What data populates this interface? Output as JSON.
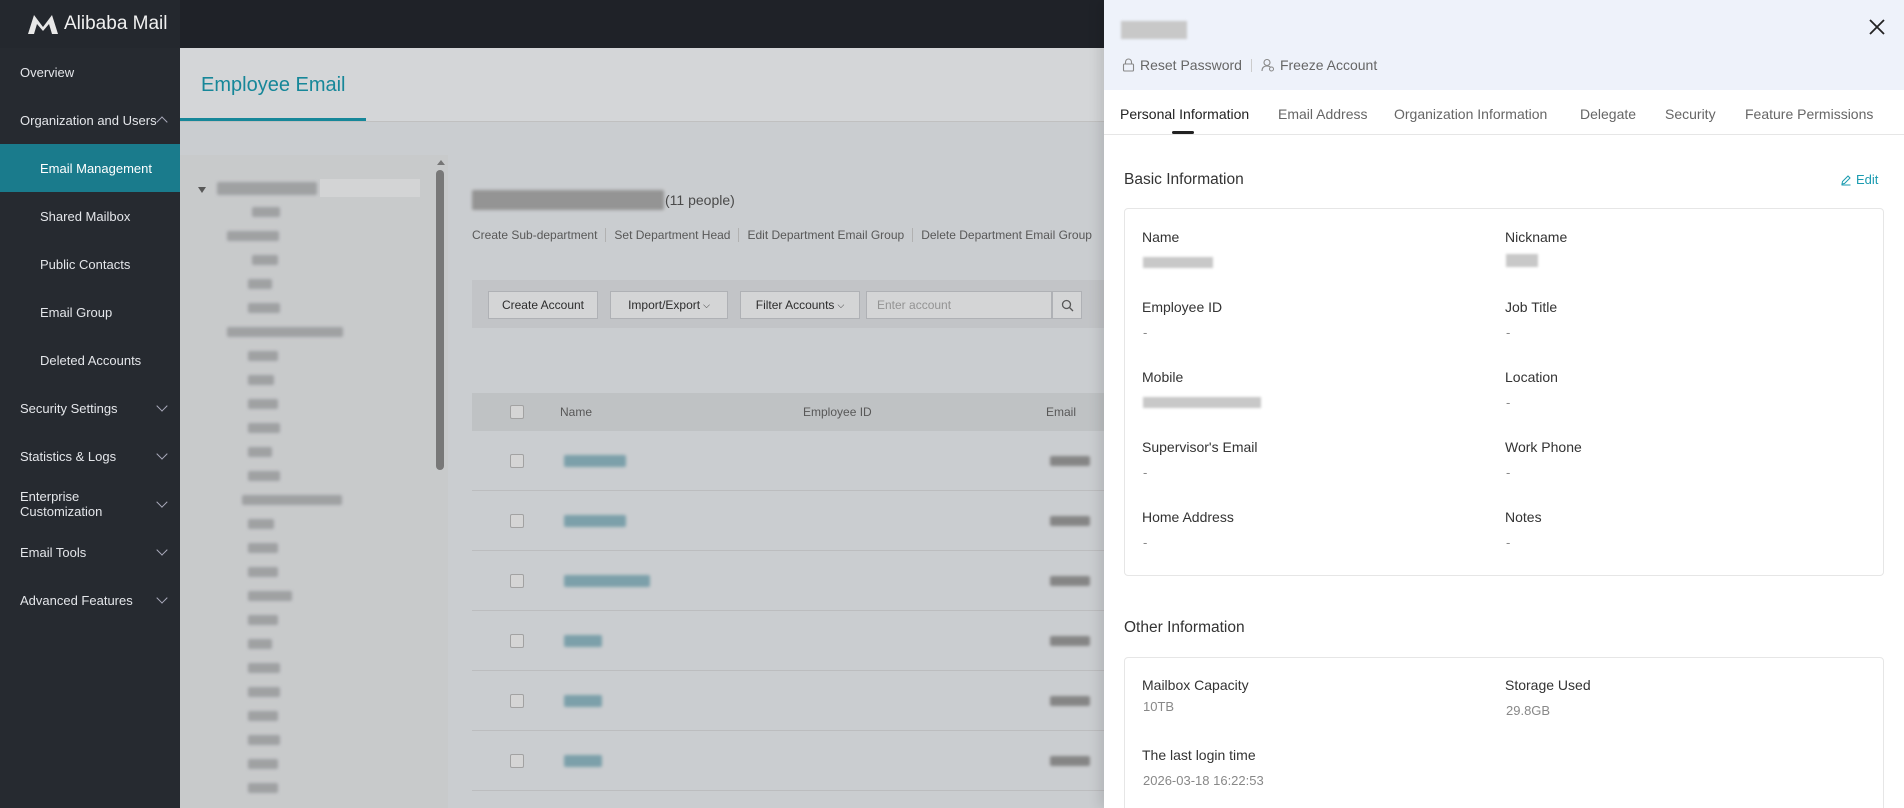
{
  "app": {
    "brand": "Alibaba Mail",
    "accent": "#1a7b8c",
    "link_color": "#1a9bb0"
  },
  "sidebar": {
    "items": [
      {
        "label": "Overview"
      },
      {
        "label": "Organization and Users"
      },
      {
        "label": "Email Management"
      },
      {
        "label": "Shared Mailbox"
      },
      {
        "label": "Public Contacts"
      },
      {
        "label": "Email Group"
      },
      {
        "label": "Deleted Accounts"
      },
      {
        "label": "Security Settings"
      },
      {
        "label": "Statistics & Logs"
      },
      {
        "label": "Enterprise Customization"
      },
      {
        "label": "Email Tools"
      },
      {
        "label": "Advanced Features"
      }
    ]
  },
  "main": {
    "title": "Employee Email",
    "dept_count": "(11 people)",
    "dept_links": [
      "Create Sub-department",
      "Set Department Head",
      "Edit Department Email Group",
      "Delete Department Email Group"
    ],
    "toolbar": {
      "create": "Create Account",
      "import_export": "Import/Export",
      "filter": "Filter Accounts",
      "search_placeholder": "Enter account"
    },
    "table": {
      "columns": [
        "Name",
        "Employee ID",
        "Email"
      ]
    }
  },
  "drawer": {
    "actions": {
      "reset": "Reset Password",
      "freeze": "Freeze Account"
    },
    "tabs": [
      "Personal Information",
      "Email Address",
      "Organization Information",
      "Delegate",
      "Security",
      "Feature Permissions"
    ],
    "basic": {
      "title": "Basic Information",
      "edit": "Edit",
      "fields": {
        "name": "Name",
        "nickname": "Nickname",
        "employee_id": "Employee ID",
        "employee_id_val": "-",
        "job_title": "Job Title",
        "job_title_val": "-",
        "mobile": "Mobile",
        "location": "Location",
        "location_val": "-",
        "supervisor_email": "Supervisor's Email",
        "supervisor_email_val": "-",
        "work_phone": "Work Phone",
        "work_phone_val": "-",
        "home_address": "Home Address",
        "home_address_val": "-",
        "notes": "Notes",
        "notes_val": "-"
      }
    },
    "other": {
      "title": "Other Information",
      "capacity_label": "Mailbox Capacity",
      "capacity_val": "10TB",
      "storage_label": "Storage Used",
      "storage_val": "29.8GB",
      "last_login_label": "The last login time",
      "last_login_val": "2026-03-18 16:22:53"
    }
  }
}
